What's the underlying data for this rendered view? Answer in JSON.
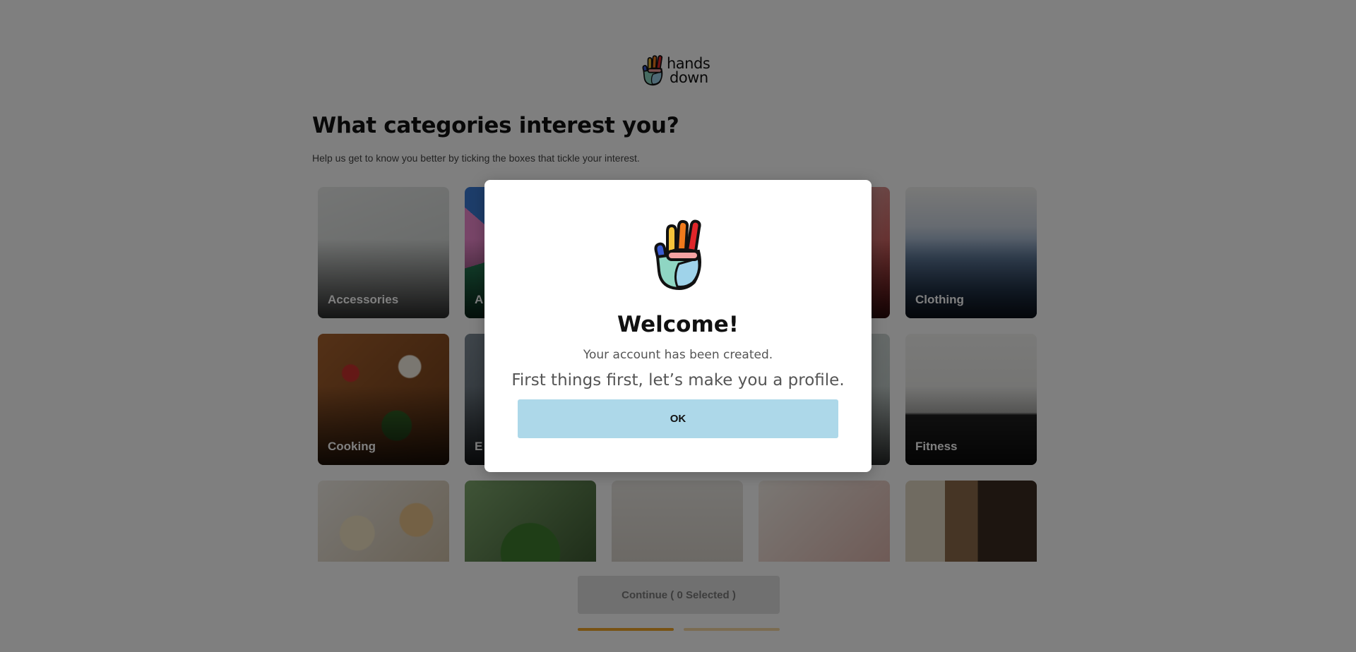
{
  "header": {
    "logo_line1": "hands",
    "logo_line2": "down",
    "logo_icon": "peace-hand-icon"
  },
  "main": {
    "title": "What categories interest you?",
    "subtitle": "Help us get to know you better by ticking the boxes that tickle your interest.",
    "categories": [
      {
        "label": "Accessories"
      },
      {
        "label": "A"
      },
      {
        "label": ""
      },
      {
        "label": ""
      },
      {
        "label": "Clothing"
      },
      {
        "label": "Cooking"
      },
      {
        "label": "E"
      },
      {
        "label": ""
      },
      {
        "label": ""
      },
      {
        "label": "Fitness"
      },
      {
        "label": ""
      },
      {
        "label": ""
      },
      {
        "label": ""
      },
      {
        "label": ""
      },
      {
        "label": ""
      }
    ]
  },
  "footer": {
    "continue_label": "Continue ( 0 Selected )",
    "progress_steps": 2,
    "progress_current": 1,
    "colors": {
      "step_active": "#f0a526",
      "step_inactive": "#f6d9a2"
    }
  },
  "modal": {
    "icon": "peace-hand-icon",
    "title": "Welcome!",
    "message": "Your account has been created.",
    "lead": "First things first, let’s make you a profile.",
    "ok_label": "OK",
    "colors": {
      "ok_button": "#add8e9"
    }
  }
}
